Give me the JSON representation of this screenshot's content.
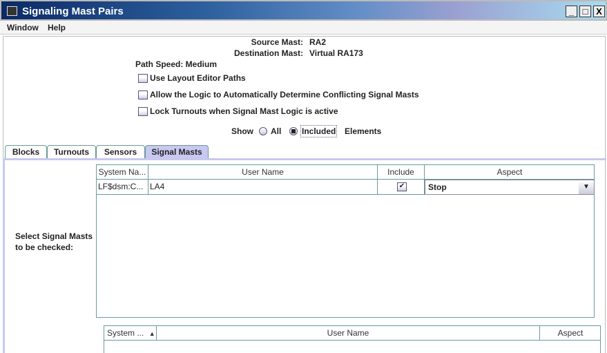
{
  "window": {
    "title": "Signaling Mast Pairs",
    "controls": [
      "_",
      "□",
      "X"
    ]
  },
  "menu": [
    "Window",
    "Help"
  ],
  "header": {
    "source_label": "Source Mast:",
    "source_value": "RA2",
    "dest_label": "Destination Mast:",
    "dest_value": "Virtual RA173",
    "path_speed": "Path Speed: Medium"
  },
  "options": [
    {
      "label": "Use Layout Editor Paths",
      "checked": false
    },
    {
      "label": "Allow the Logic to Automatically Determine Conflicting Signal Masts",
      "checked": false
    },
    {
      "label": "Lock Turnouts when Signal Mast Logic is active",
      "checked": false
    }
  ],
  "show": {
    "label": "Show",
    "all": "All",
    "included": "Included",
    "elements": "Elements",
    "selected": "Included"
  },
  "tabs": [
    {
      "label": "Blocks"
    },
    {
      "label": "Turnouts"
    },
    {
      "label": "Sensors"
    },
    {
      "label": "Signal Masts",
      "selected": true
    }
  ],
  "side_label": [
    "Select Signal Masts",
    "to be checked:"
  ],
  "table1": {
    "columns": [
      "System Na...",
      "User Name",
      "Include",
      "Aspect"
    ],
    "rows": [
      {
        "system": "LF$dsm:C...",
        "user": "LA4",
        "include": true,
        "aspect": "Stop"
      }
    ]
  },
  "table2": {
    "columns": [
      "System ...",
      "User Name",
      "Aspect"
    ],
    "sort": "ascending"
  }
}
